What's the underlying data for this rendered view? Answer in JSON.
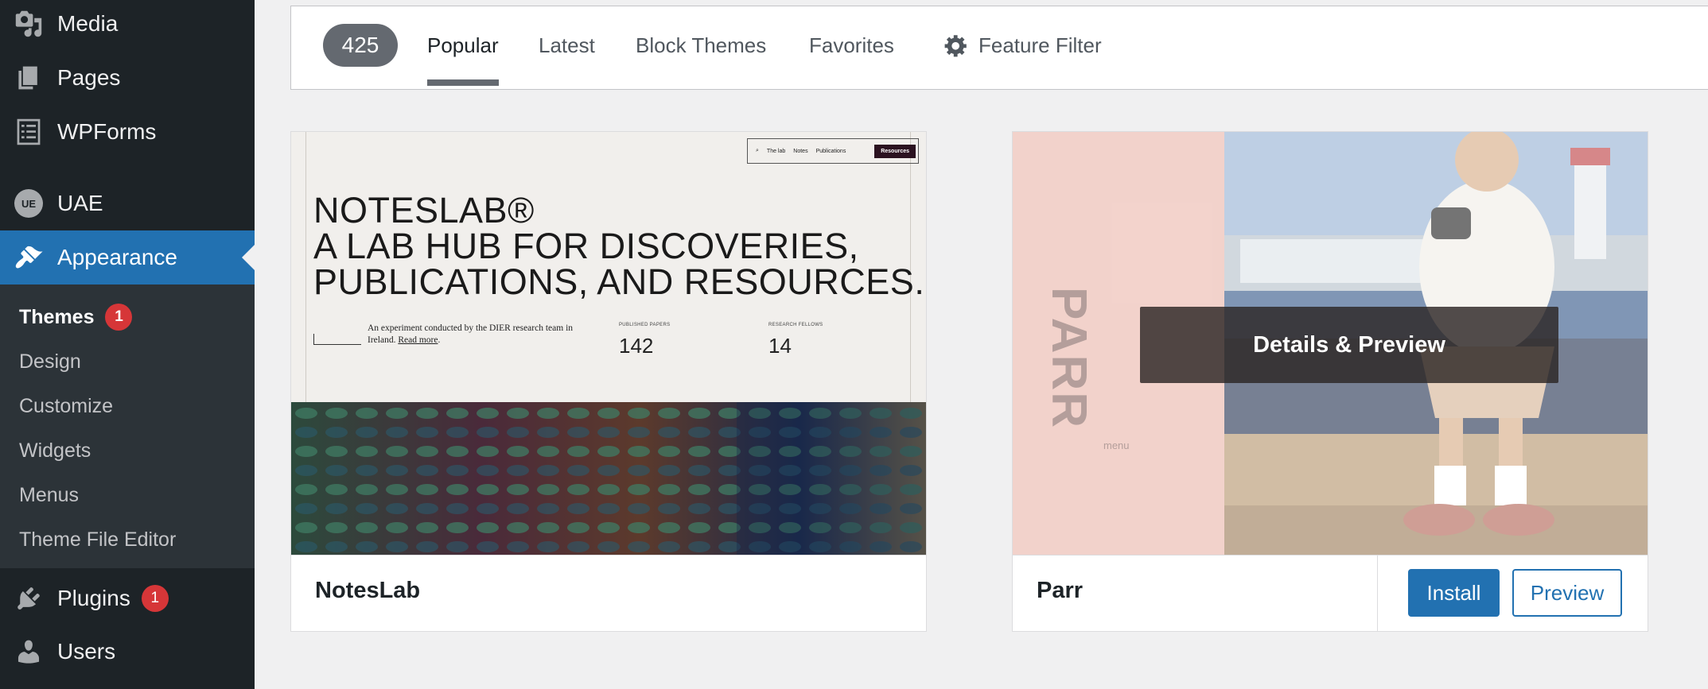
{
  "sidebar": {
    "items": [
      {
        "label": "Media",
        "icon": "media-icon"
      },
      {
        "label": "Pages",
        "icon": "pages-icon"
      },
      {
        "label": "WPForms",
        "icon": "wpforms-icon"
      },
      {
        "label": "UAE",
        "icon": "uae-logo-icon",
        "logo_text": "UE"
      },
      {
        "label": "Appearance",
        "icon": "paintbrush-icon",
        "active": true
      },
      {
        "label": "Plugins",
        "icon": "plugin-icon",
        "badge": "1"
      },
      {
        "label": "Users",
        "icon": "user-icon"
      }
    ],
    "submenu": [
      {
        "label": "Themes",
        "badge": "1",
        "current": true
      },
      {
        "label": "Design"
      },
      {
        "label": "Customize"
      },
      {
        "label": "Widgets"
      },
      {
        "label": "Menus"
      },
      {
        "label": "Theme File Editor"
      }
    ]
  },
  "filter_bar": {
    "count": "425",
    "tabs": [
      {
        "label": "Popular",
        "current": true
      },
      {
        "label": "Latest"
      },
      {
        "label": "Block Themes"
      },
      {
        "label": "Favorites"
      }
    ],
    "feature_filter": "Feature Filter"
  },
  "themes": [
    {
      "name": "NotesLab",
      "screenshot": {
        "nav": [
          "The lab",
          "Notes",
          "Publications",
          "Resources"
        ],
        "heading_lines": [
          "NOTESLAB®",
          "A LAB HUB FOR DISCOVERIES,",
          "PUBLICATIONS, AND RESOURCES."
        ],
        "description": "An experiment conducted by the DIER research team in Ireland.",
        "read_more": "Read more",
        "stats": [
          {
            "label": "PUBLISHED PAPERS",
            "value": "142"
          },
          {
            "label": "RESEARCH FELLOWS",
            "value": "14"
          }
        ]
      }
    },
    {
      "name": "Parr",
      "screenshot": {
        "word": "PARR",
        "menu": "menu"
      },
      "hover_label": "Details & Preview",
      "install_label": "Install",
      "preview_label": "Preview"
    }
  ],
  "colors": {
    "sidebar_bg": "#1d2327",
    "submenu_bg": "#2c3338",
    "accent": "#2271b1",
    "badge": "#d63638",
    "page_bg": "#f0f0f1"
  }
}
